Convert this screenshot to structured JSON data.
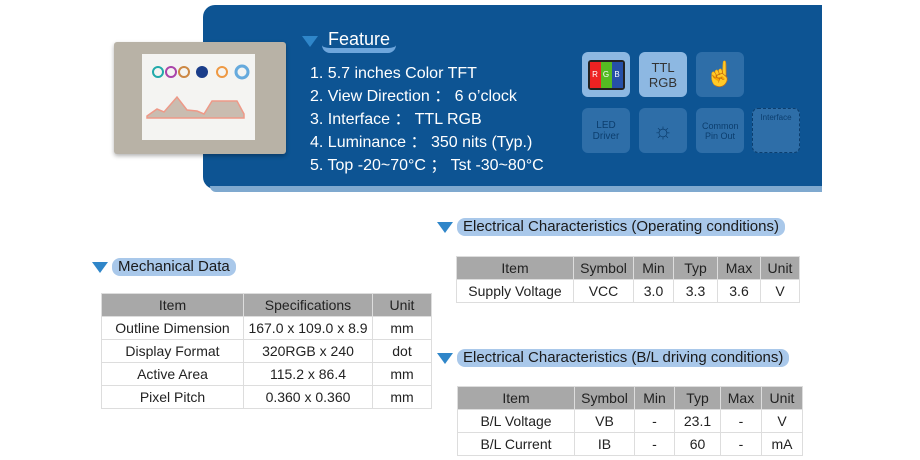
{
  "feature": {
    "title": "Feature",
    "items": [
      "1.  5.7 inches Color TFT",
      "2.  View Direction ： 6 o’clock",
      "3.  Interface ： TTL RGB",
      "4.  Luminance ： 350 nits (Typ.)",
      "5.  Top -20~70°C ； Tst -30~80°C"
    ]
  },
  "icons": {
    "rgb": [
      "R",
      "G",
      "B"
    ],
    "ttl": "TTL",
    "ttl2": "RGB",
    "led": "LED Driver",
    "common": "Common Pin Out",
    "interface": "Interface"
  },
  "mechanical": {
    "title": "Mechanical Data",
    "headers": [
      "Item",
      "Specifications",
      "Unit"
    ],
    "rows": [
      [
        "Outline Dimension",
        "167.0 x 109.0 x 8.9",
        "mm"
      ],
      [
        "Display Format",
        "320RGB x 240",
        "dot"
      ],
      [
        "Active Area",
        "115.2 x 86.4",
        "mm"
      ],
      [
        "Pixel Pitch",
        "0.360 x 0.360",
        "mm"
      ]
    ]
  },
  "elec_op": {
    "title": "Electrical Characteristics (Operating conditions)",
    "headers": [
      "Item",
      "Symbol",
      "Min",
      "Typ",
      "Max",
      "Unit"
    ],
    "rows": [
      [
        "Supply Voltage",
        "VCC",
        "3.0",
        "3.3",
        "3.6",
        "V"
      ]
    ]
  },
  "elec_bl": {
    "title": "Electrical Characteristics (B/L driving conditions)",
    "headers": [
      "Item",
      "Symbol",
      "Min",
      "Typ",
      "Max",
      "Unit"
    ],
    "rows": [
      [
        "B/L Voltage",
        "VB",
        "-",
        "23.1",
        "-",
        "V"
      ],
      [
        "B/L Current",
        "IB",
        "-",
        "60",
        "-",
        "mA"
      ]
    ]
  }
}
